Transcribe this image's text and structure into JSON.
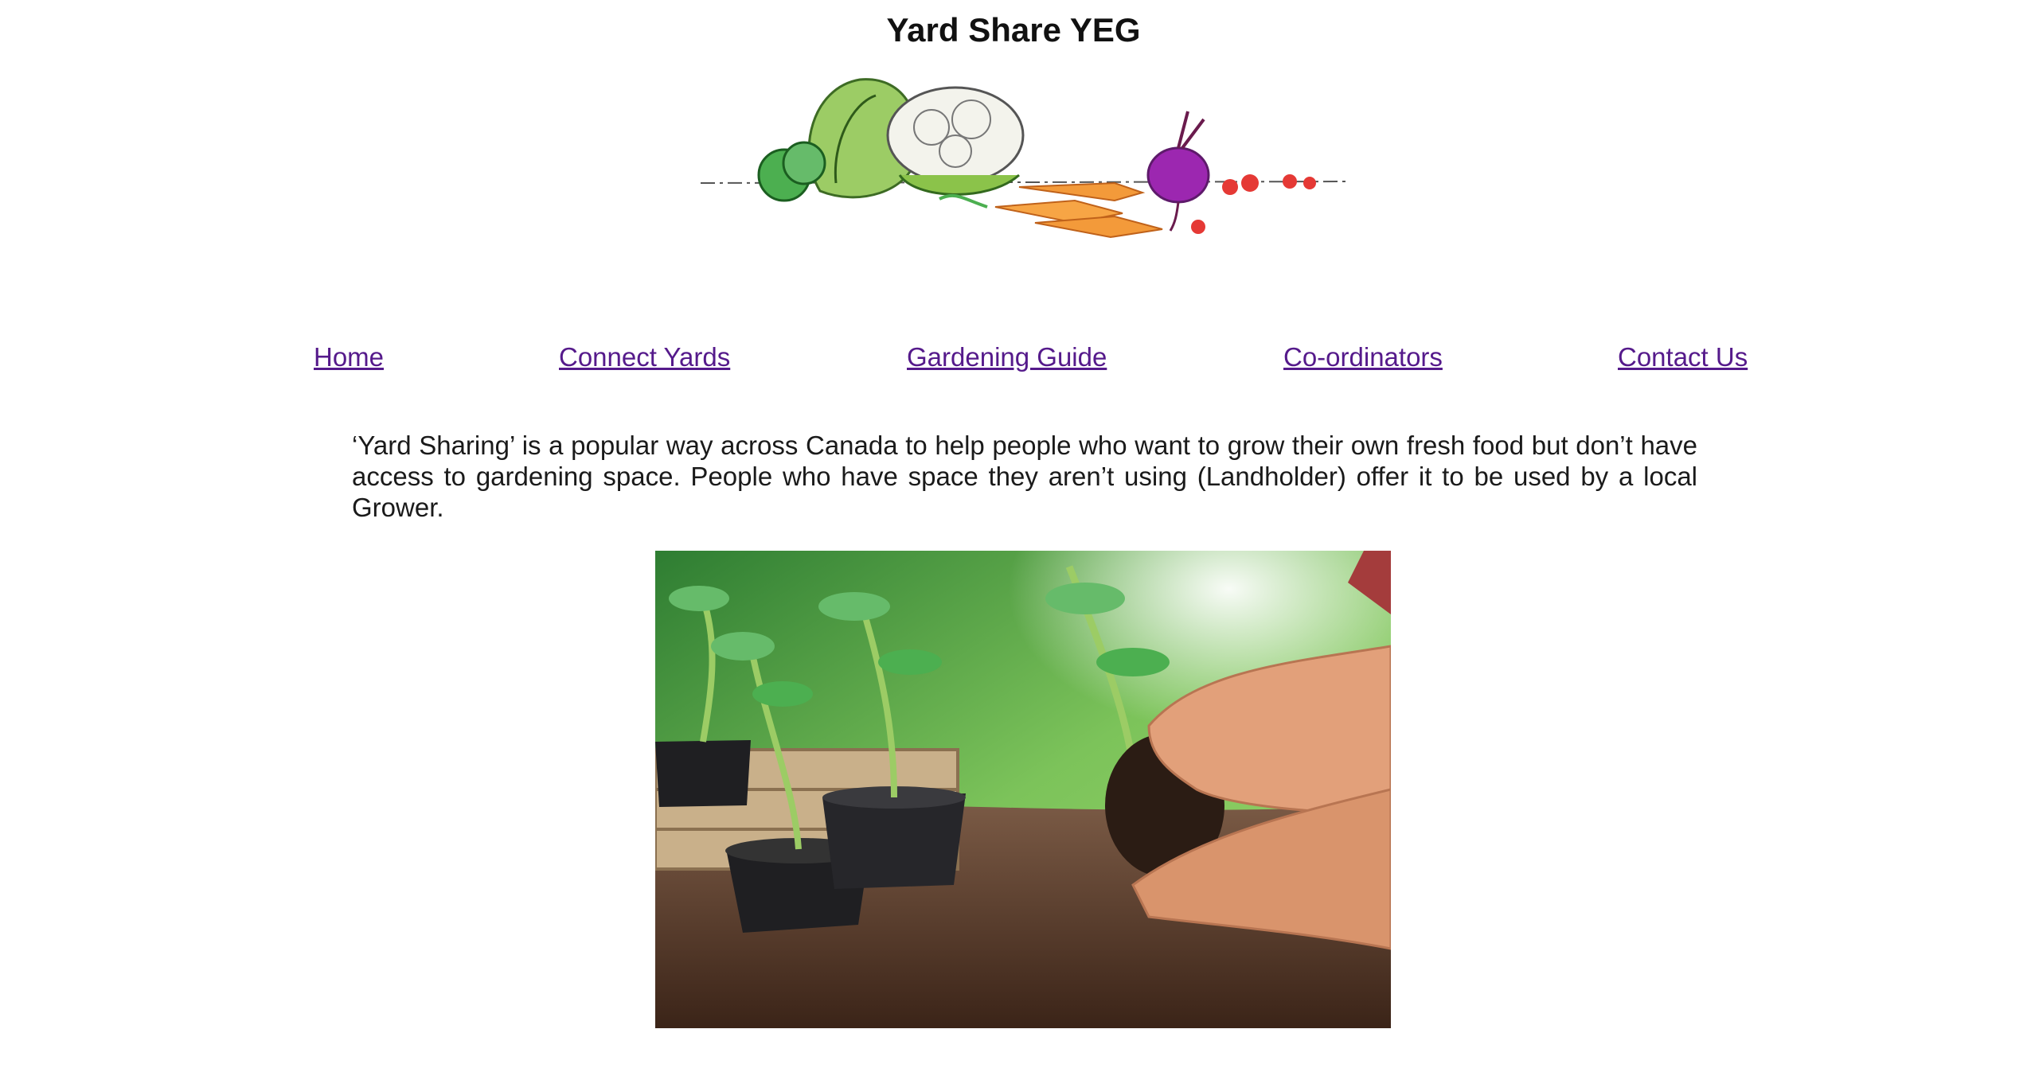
{
  "header": {
    "title": "Yard Share YEG"
  },
  "banner": {
    "icon": "vegetables-illustration-icon"
  },
  "nav": {
    "links": [
      {
        "label": "Home"
      },
      {
        "label": "Connect Yards"
      },
      {
        "label": "Gardening Guide"
      },
      {
        "label": "Co-ordinators"
      },
      {
        "label": "Contact Us"
      }
    ],
    "link_color": "#551a8b"
  },
  "main": {
    "intro": "‘Yard Sharing’ is a popular way across Canada to help people who want to grow their own fresh food but don’t have access to gardening space. People who have space they aren’t using (Landholder) offer it to be used by a local Grower.",
    "photo_icon": "planting-seedlings-photo"
  }
}
